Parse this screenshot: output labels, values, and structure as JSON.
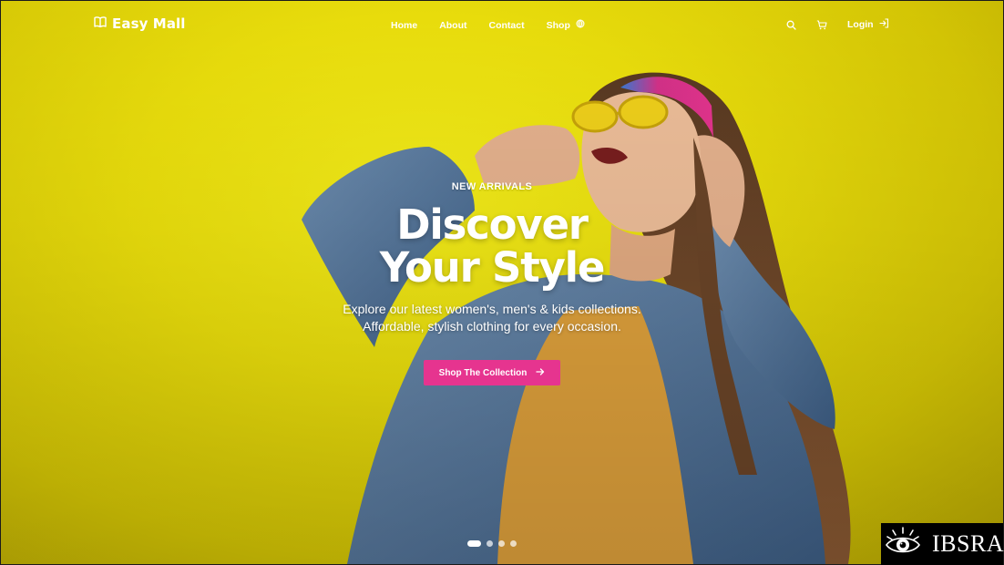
{
  "brand": {
    "name": "Easy Mall",
    "icon": "book-open-icon"
  },
  "nav": {
    "links": [
      {
        "label": "Home"
      },
      {
        "label": "About"
      },
      {
        "label": "Contact"
      },
      {
        "label": "Shop",
        "icon": "globe-icon"
      }
    ],
    "search_icon": "search-icon",
    "cart_icon": "cart-icon",
    "login_label": "Login",
    "login_icon": "sign-in-icon"
  },
  "hero": {
    "eyebrow": "NEW ARRIVALS",
    "title": "Discover Your Style",
    "subtitle": "Explore our latest women's, men's & kids collections. Affordable, stylish clothing for every occasion.",
    "cta_label": "Shop The Collection",
    "cta_icon": "arrow-right-icon",
    "slides_total": 4,
    "active_slide": 1
  },
  "colors": {
    "background": "#eee30e",
    "accent": "#e6348f",
    "text": "#ffffff"
  },
  "watermark": {
    "text": "IBSRA"
  }
}
